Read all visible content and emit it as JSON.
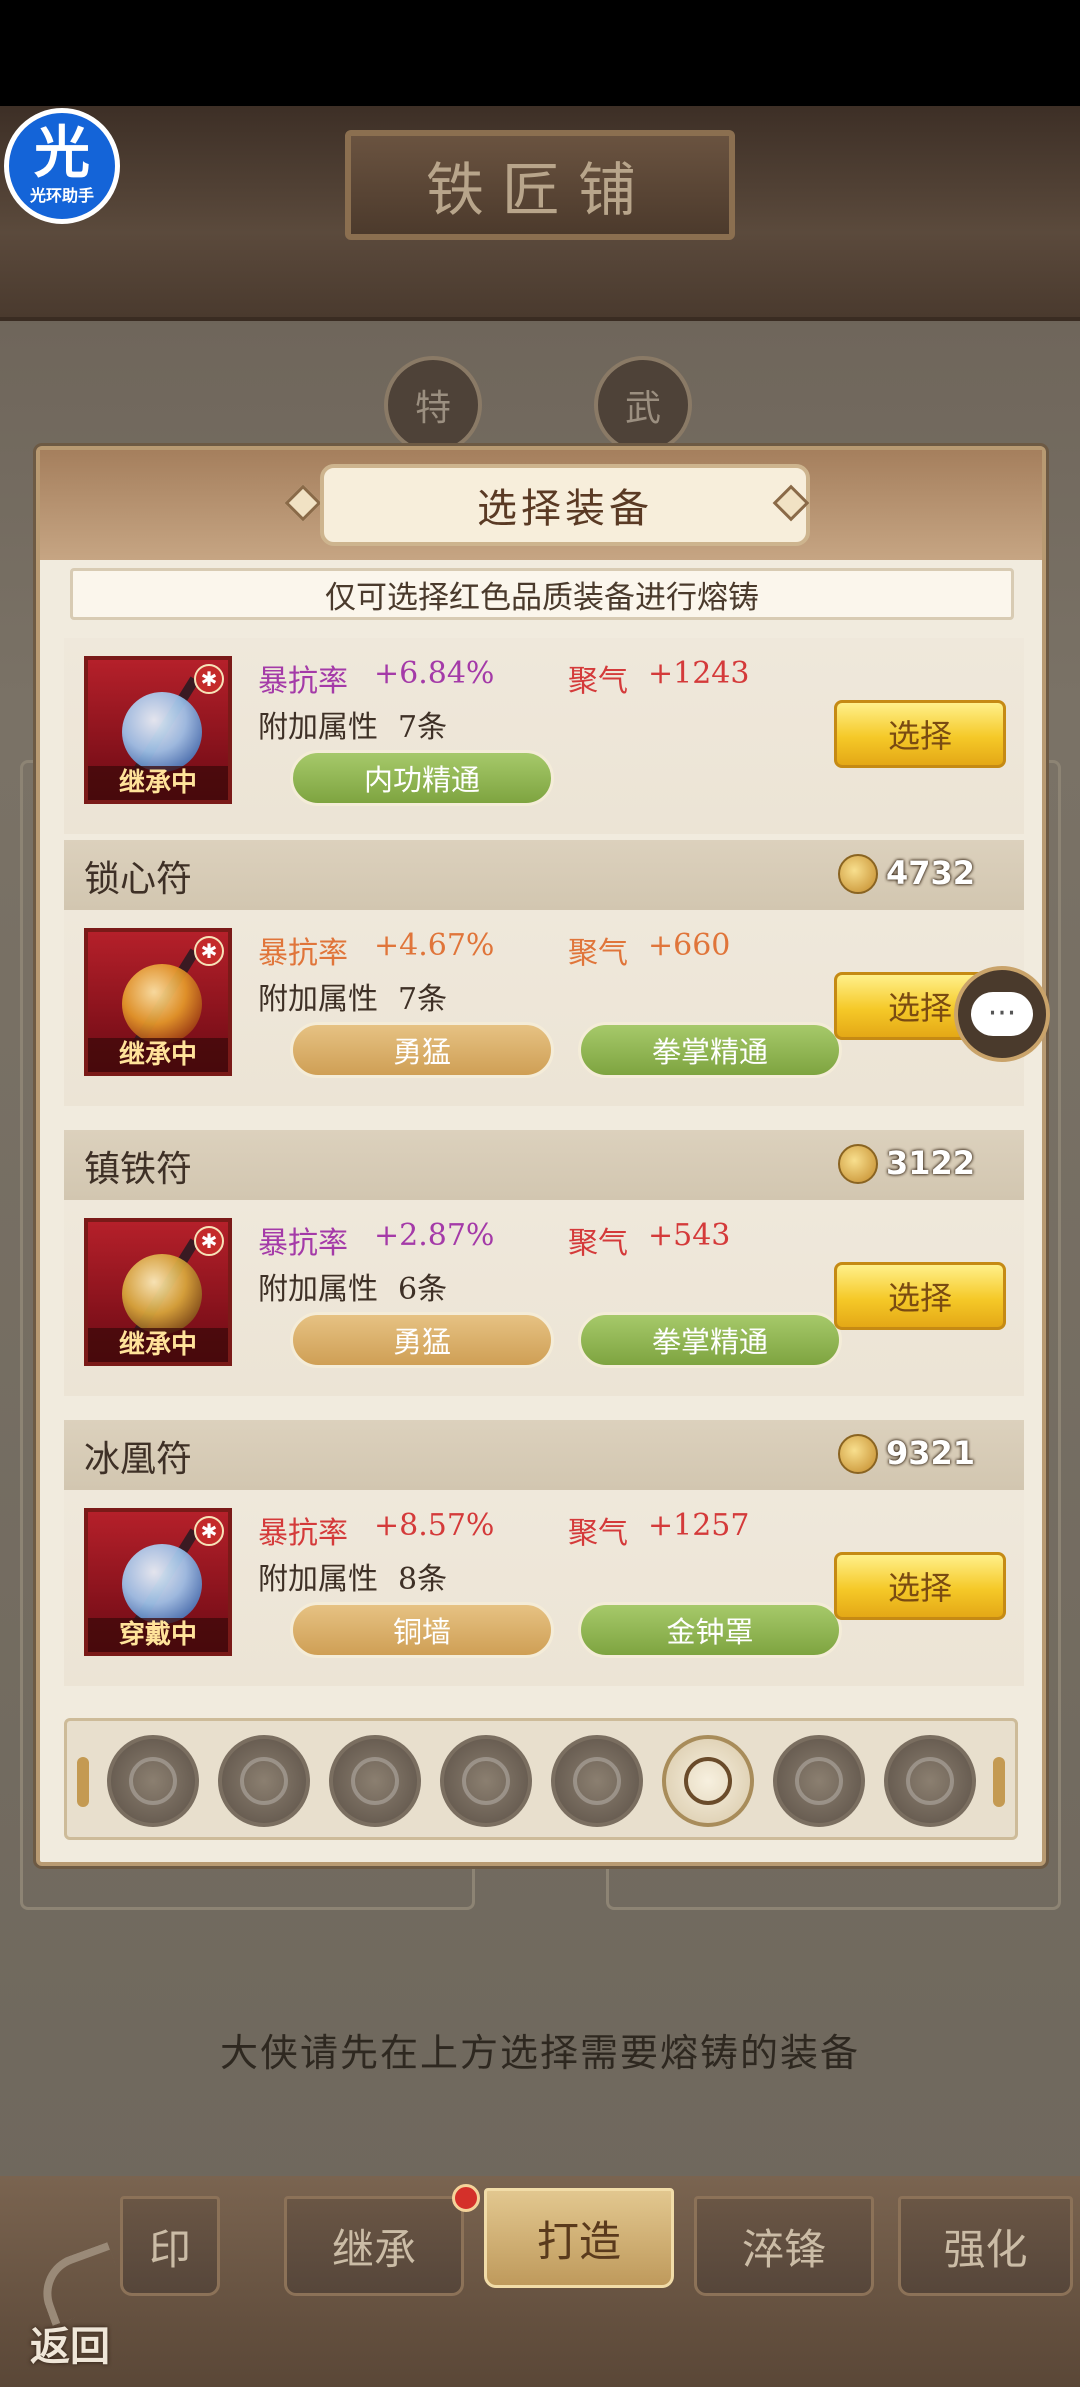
{
  "header": {
    "shop_title": "铁匠铺"
  },
  "badge": {
    "glyph": "光",
    "label": "光环助手"
  },
  "background": {
    "circle_left": "特",
    "circle_right": "武"
  },
  "modal": {
    "title": "选择装备",
    "notice": "仅可选择红色品质装备进行熔铸",
    "items": [
      {
        "name": "",
        "price": "",
        "status": "继承中",
        "stat1_label": "暴抗率",
        "stat1_value": "+6.84%",
        "stat2_label": "聚气",
        "stat2_value": "+1243",
        "extra_label": "附加属性",
        "extra_value": "7条",
        "tags": [
          "内功精通"
        ],
        "select_label": "选择"
      },
      {
        "name": "锁心符",
        "price": "4732",
        "status": "继承中",
        "stat1_label": "暴抗率",
        "stat1_value": "+4.67%",
        "stat2_label": "聚气",
        "stat2_value": "+660",
        "extra_label": "附加属性",
        "extra_value": "7条",
        "tags": [
          "勇猛",
          "拳掌精通"
        ],
        "select_label": "选择"
      },
      {
        "name": "镇铁符",
        "price": "3122",
        "status": "继承中",
        "stat1_label": "暴抗率",
        "stat1_value": "+2.87%",
        "stat2_label": "聚气",
        "stat2_value": "+543",
        "extra_label": "附加属性",
        "extra_value": "6条",
        "tags": [
          "勇猛",
          "拳掌精通"
        ],
        "select_label": "选择"
      },
      {
        "name": "冰凰符",
        "price": "9321",
        "status": "穿戴中",
        "stat1_label": "暴抗率",
        "stat1_value": "+8.57%",
        "stat2_label": "聚气",
        "stat2_value": "+1257",
        "extra_label": "附加属性",
        "extra_value": "8条",
        "tags": [
          "铜墙",
          "金钟罩"
        ],
        "select_label": "选择"
      }
    ],
    "slot_icons": [
      "weapon-slot-icon",
      "helmet-slot-icon",
      "armor-slot-icon",
      "boots-slot-icon",
      "belt-slot-icon",
      "talisman-slot-icon",
      "scroll-slot-icon",
      "ring-slot-icon"
    ]
  },
  "hint": "大侠请先在上方选择需要熔铸的装备",
  "tabs": [
    "印",
    "继承",
    "打造",
    "淬锋",
    "强化"
  ],
  "back_label": "返回",
  "colors": {
    "accent_gold": "#f5c928",
    "stat_purple": "#a43aa8",
    "stat_red": "#d43a3a",
    "tag_green": "#7ea440",
    "tag_tan": "#cf9f55"
  }
}
